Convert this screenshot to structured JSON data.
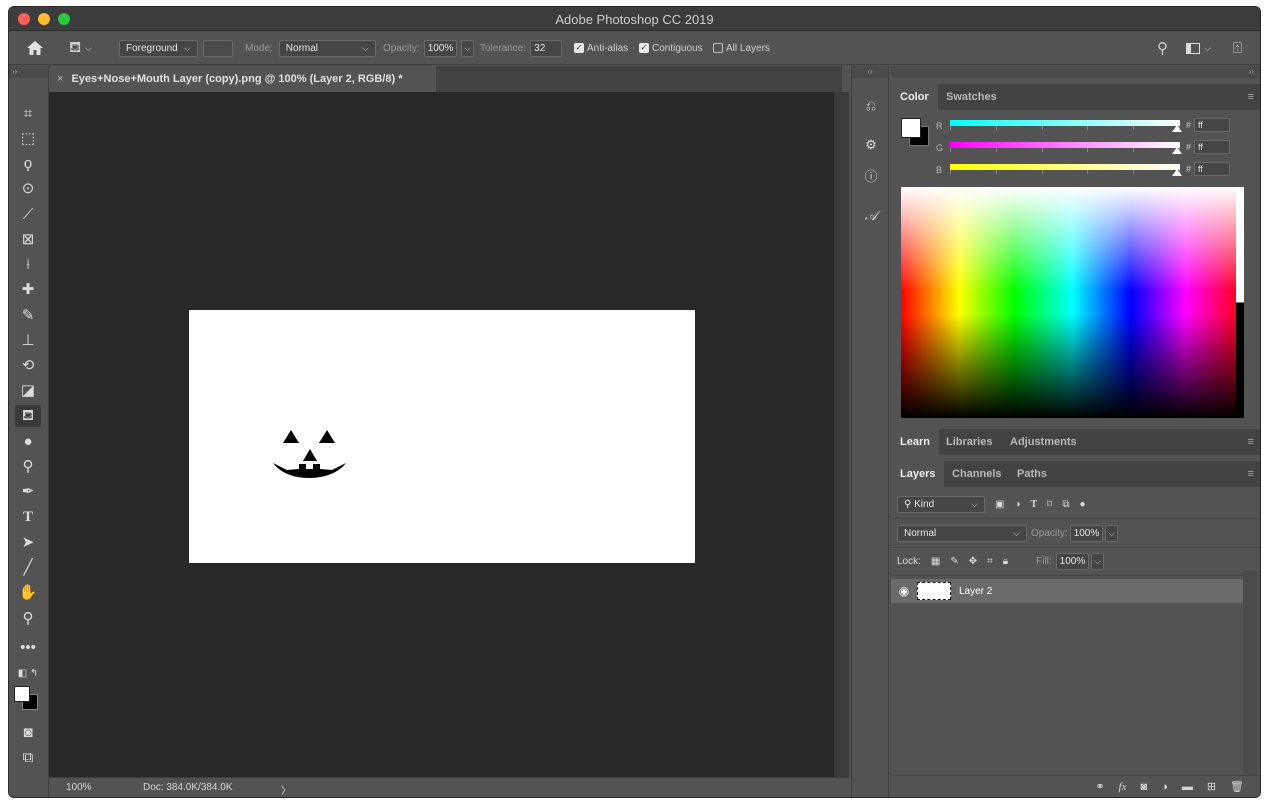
{
  "window": {
    "title": "Adobe Photoshop CC 2019"
  },
  "options_bar": {
    "fill_source": "Foreground",
    "mode_label": "Mode:",
    "mode_value": "Normal",
    "opacity_label": "Opacity:",
    "opacity_value": "100%",
    "tolerance_label": "Tolerance:",
    "tolerance_value": "32",
    "anti_alias_label": "Anti-alias",
    "anti_alias_checked": true,
    "contiguous_label": "Contiguous",
    "contiguous_checked": true,
    "all_layers_label": "All Layers",
    "all_layers_checked": false
  },
  "document": {
    "tab_title": "Eyes+Nose+Mouth Layer (copy).png @ 100% (Layer 2, RGB/8) *",
    "zoom": "100%",
    "doc_size": "Doc: 384.0K/384.0K",
    "status_arrow": "〉"
  },
  "color_panel": {
    "tabs": [
      "Color",
      "Swatches"
    ],
    "active_tab": "Color",
    "channels": [
      {
        "label": "R",
        "hex": "ff",
        "gradient": [
          "#00ffff",
          "#ffffff"
        ]
      },
      {
        "label": "G",
        "hex": "ff",
        "gradient": [
          "#ff00ff",
          "#ffffff"
        ]
      },
      {
        "label": "B",
        "hex": "ff",
        "gradient": [
          "#ffff00",
          "#ffffff"
        ]
      }
    ],
    "foreground": "#ffffff",
    "background": "#000000"
  },
  "learn_panel": {
    "tabs": [
      "Learn",
      "Libraries",
      "Adjustments"
    ]
  },
  "layers_panel": {
    "tabs": [
      "Layers",
      "Channels",
      "Paths"
    ],
    "filter_label": "Kind",
    "blend_mode": "Normal",
    "opacity_label": "Opacity:",
    "opacity_value": "100%",
    "lock_label": "Lock:",
    "fill_label": "Fill:",
    "fill_value": "100%",
    "layers": [
      {
        "name": "Layer 2",
        "visible": true
      }
    ]
  }
}
